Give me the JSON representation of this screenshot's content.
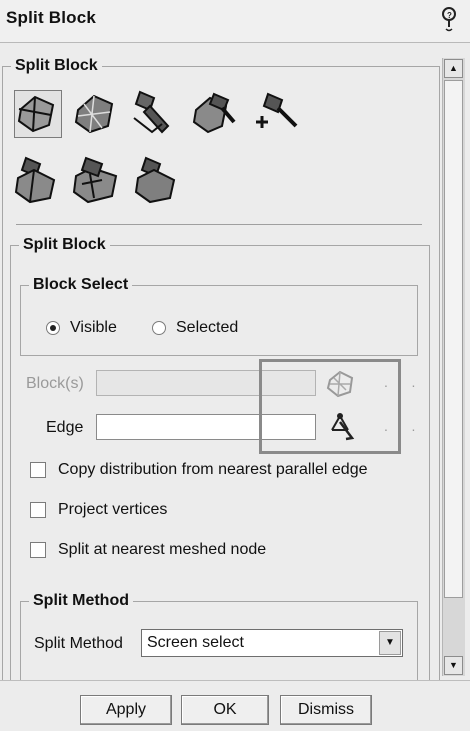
{
  "window": {
    "title": "Split Block"
  },
  "panel": {
    "title": "Split Block"
  },
  "split_section": {
    "title": "Split Block"
  },
  "block_select": {
    "title": "Block Select",
    "options": [
      {
        "label": "Visible",
        "selected": true
      },
      {
        "label": "Selected",
        "selected": false
      }
    ]
  },
  "fields": {
    "blocks": {
      "label": "Block(s)",
      "value": "",
      "enabled": false,
      "more": ". . ."
    },
    "edge": {
      "label": "Edge",
      "value": "",
      "enabled": true,
      "more": ". . ."
    }
  },
  "checkboxes": [
    {
      "label": "Copy distribution from nearest parallel edge",
      "checked": false
    },
    {
      "label": "Project vertices",
      "checked": false
    },
    {
      "label": "Split at nearest meshed node",
      "checked": false
    }
  ],
  "split_method": {
    "title": "Split Method",
    "label": "Split Method",
    "value": "Screen select"
  },
  "buttons": {
    "apply": "Apply",
    "ok": "OK",
    "dismiss": "Dismiss"
  },
  "toolbar_icons": [
    "split-block-icon",
    "split-block-mesh-icon",
    "split-face-icon",
    "split-edge-icon",
    "split-vertex-icon",
    "split-prism-icon",
    "split-ogrid-icon",
    "split-free-icon"
  ]
}
